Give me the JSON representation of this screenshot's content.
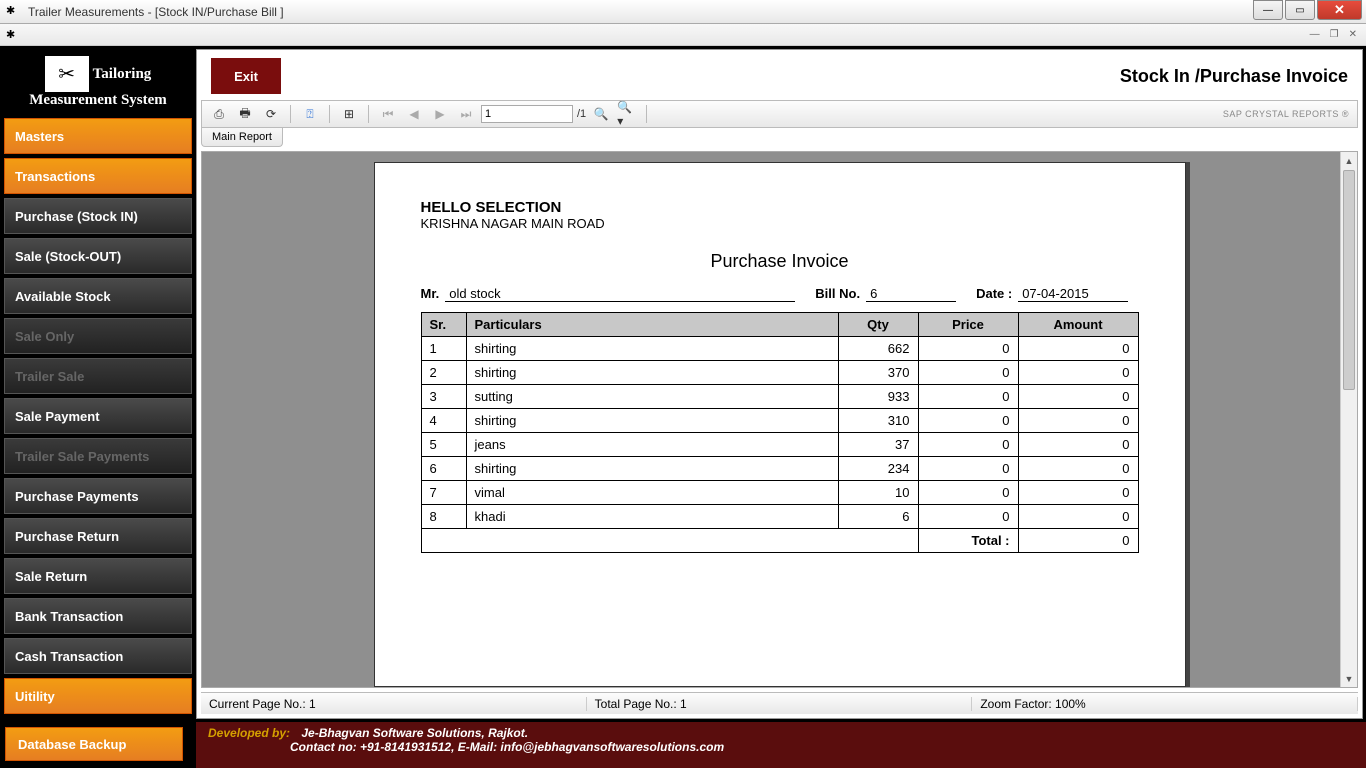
{
  "window": {
    "title": "Trailer Measurements - [Stock IN/Purchase Bill ]"
  },
  "app": {
    "name_line1": "Tailoring",
    "name_line2": "Measurement System"
  },
  "sidebar": {
    "items": [
      {
        "label": "Masters",
        "type": "orange"
      },
      {
        "label": "Transactions",
        "type": "orange"
      },
      {
        "label": "Purchase (Stock IN)",
        "type": "normal"
      },
      {
        "label": "Sale (Stock-OUT)",
        "type": "normal"
      },
      {
        "label": "Available Stock",
        "type": "normal"
      },
      {
        "label": "Sale Only",
        "type": "disabled"
      },
      {
        "label": "Trailer Sale",
        "type": "disabled"
      },
      {
        "label": "Sale Payment",
        "type": "normal"
      },
      {
        "label": "Trailer Sale Payments",
        "type": "disabled"
      },
      {
        "label": "Purchase Payments",
        "type": "normal"
      },
      {
        "label": "Purchase Return",
        "type": "normal"
      },
      {
        "label": "Sale Return",
        "type": "normal"
      },
      {
        "label": "Bank Transaction",
        "type": "normal"
      },
      {
        "label": "Cash Transaction",
        "type": "normal"
      },
      {
        "label": "Uitility",
        "type": "orange"
      }
    ]
  },
  "header": {
    "exit": "Exit",
    "title": "Stock In /Purchase Invoice"
  },
  "report_toolbar": {
    "page_input": "1",
    "page_total": "/1",
    "brand": "SAP CRYSTAL REPORTS ®"
  },
  "tabs": {
    "main": "Main Report"
  },
  "invoice": {
    "company": "HELLO SELECTION",
    "address": "KRISHNA NAGAR MAIN ROAD",
    "title": "Purchase Invoice",
    "mr_label": "Mr.",
    "mr_value": "old stock",
    "bill_label": "Bill No.",
    "bill_value": "6",
    "date_label": "Date :",
    "date_value": "07-04-2015",
    "headers": {
      "sr": "Sr.",
      "particulars": "Particulars",
      "qty": "Qty",
      "price": "Price",
      "amount": "Amount"
    },
    "rows": [
      {
        "sr": "1",
        "particulars": "shirting",
        "qty": "662",
        "price": "0",
        "amount": "0"
      },
      {
        "sr": "2",
        "particulars": "shirting",
        "qty": "370",
        "price": "0",
        "amount": "0"
      },
      {
        "sr": "3",
        "particulars": "sutting",
        "qty": "933",
        "price": "0",
        "amount": "0"
      },
      {
        "sr": "4",
        "particulars": "shirting",
        "qty": "310",
        "price": "0",
        "amount": "0"
      },
      {
        "sr": "5",
        "particulars": "jeans",
        "qty": "37",
        "price": "0",
        "amount": "0"
      },
      {
        "sr": "6",
        "particulars": "shirting",
        "qty": "234",
        "price": "0",
        "amount": "0"
      },
      {
        "sr": "7",
        "particulars": "vimal",
        "qty": "10",
        "price": "0",
        "amount": "0"
      },
      {
        "sr": "8",
        "particulars": "khadi",
        "qty": "6",
        "price": "0",
        "amount": "0"
      }
    ],
    "total_label": "Total :",
    "total_value": "0"
  },
  "status": {
    "current": "Current Page No.: 1",
    "total": "Total Page No.: 1",
    "zoom": "Zoom Factor: 100%"
  },
  "footer": {
    "backup": "Database Backup",
    "dev_label": "Developed by:",
    "dev_name": "Je-Bhagvan Software Solutions, Rajkot.",
    "contact": "Contact no: +91-8141931512, E-Mail: info@jebhagvansoftwaresolutions.com"
  }
}
